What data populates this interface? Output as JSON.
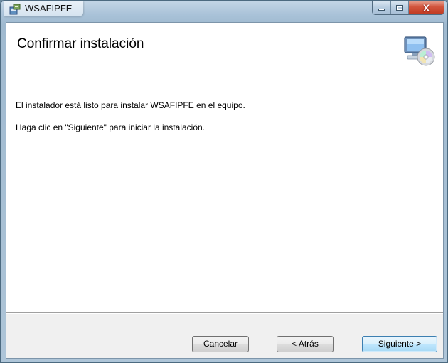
{
  "window": {
    "title": "WSAFIPFE",
    "controls": {
      "close_glyph": "X"
    }
  },
  "header": {
    "title": "Confirmar instalación",
    "icon": "computer-cd-icon"
  },
  "body": {
    "line1": "El instalador está listo para instalar WSAFIPFE en el equipo.",
    "line2": "Haga clic en \"Siguiente\" para iniciar la instalación."
  },
  "buttons": {
    "cancel": "Cancelar",
    "back": "< Atrás",
    "next": "Siguiente >"
  },
  "colors": {
    "close_button": "#c03a22",
    "default_button_border": "#3c7fb1",
    "footer_bg": "#f0f0f0"
  }
}
